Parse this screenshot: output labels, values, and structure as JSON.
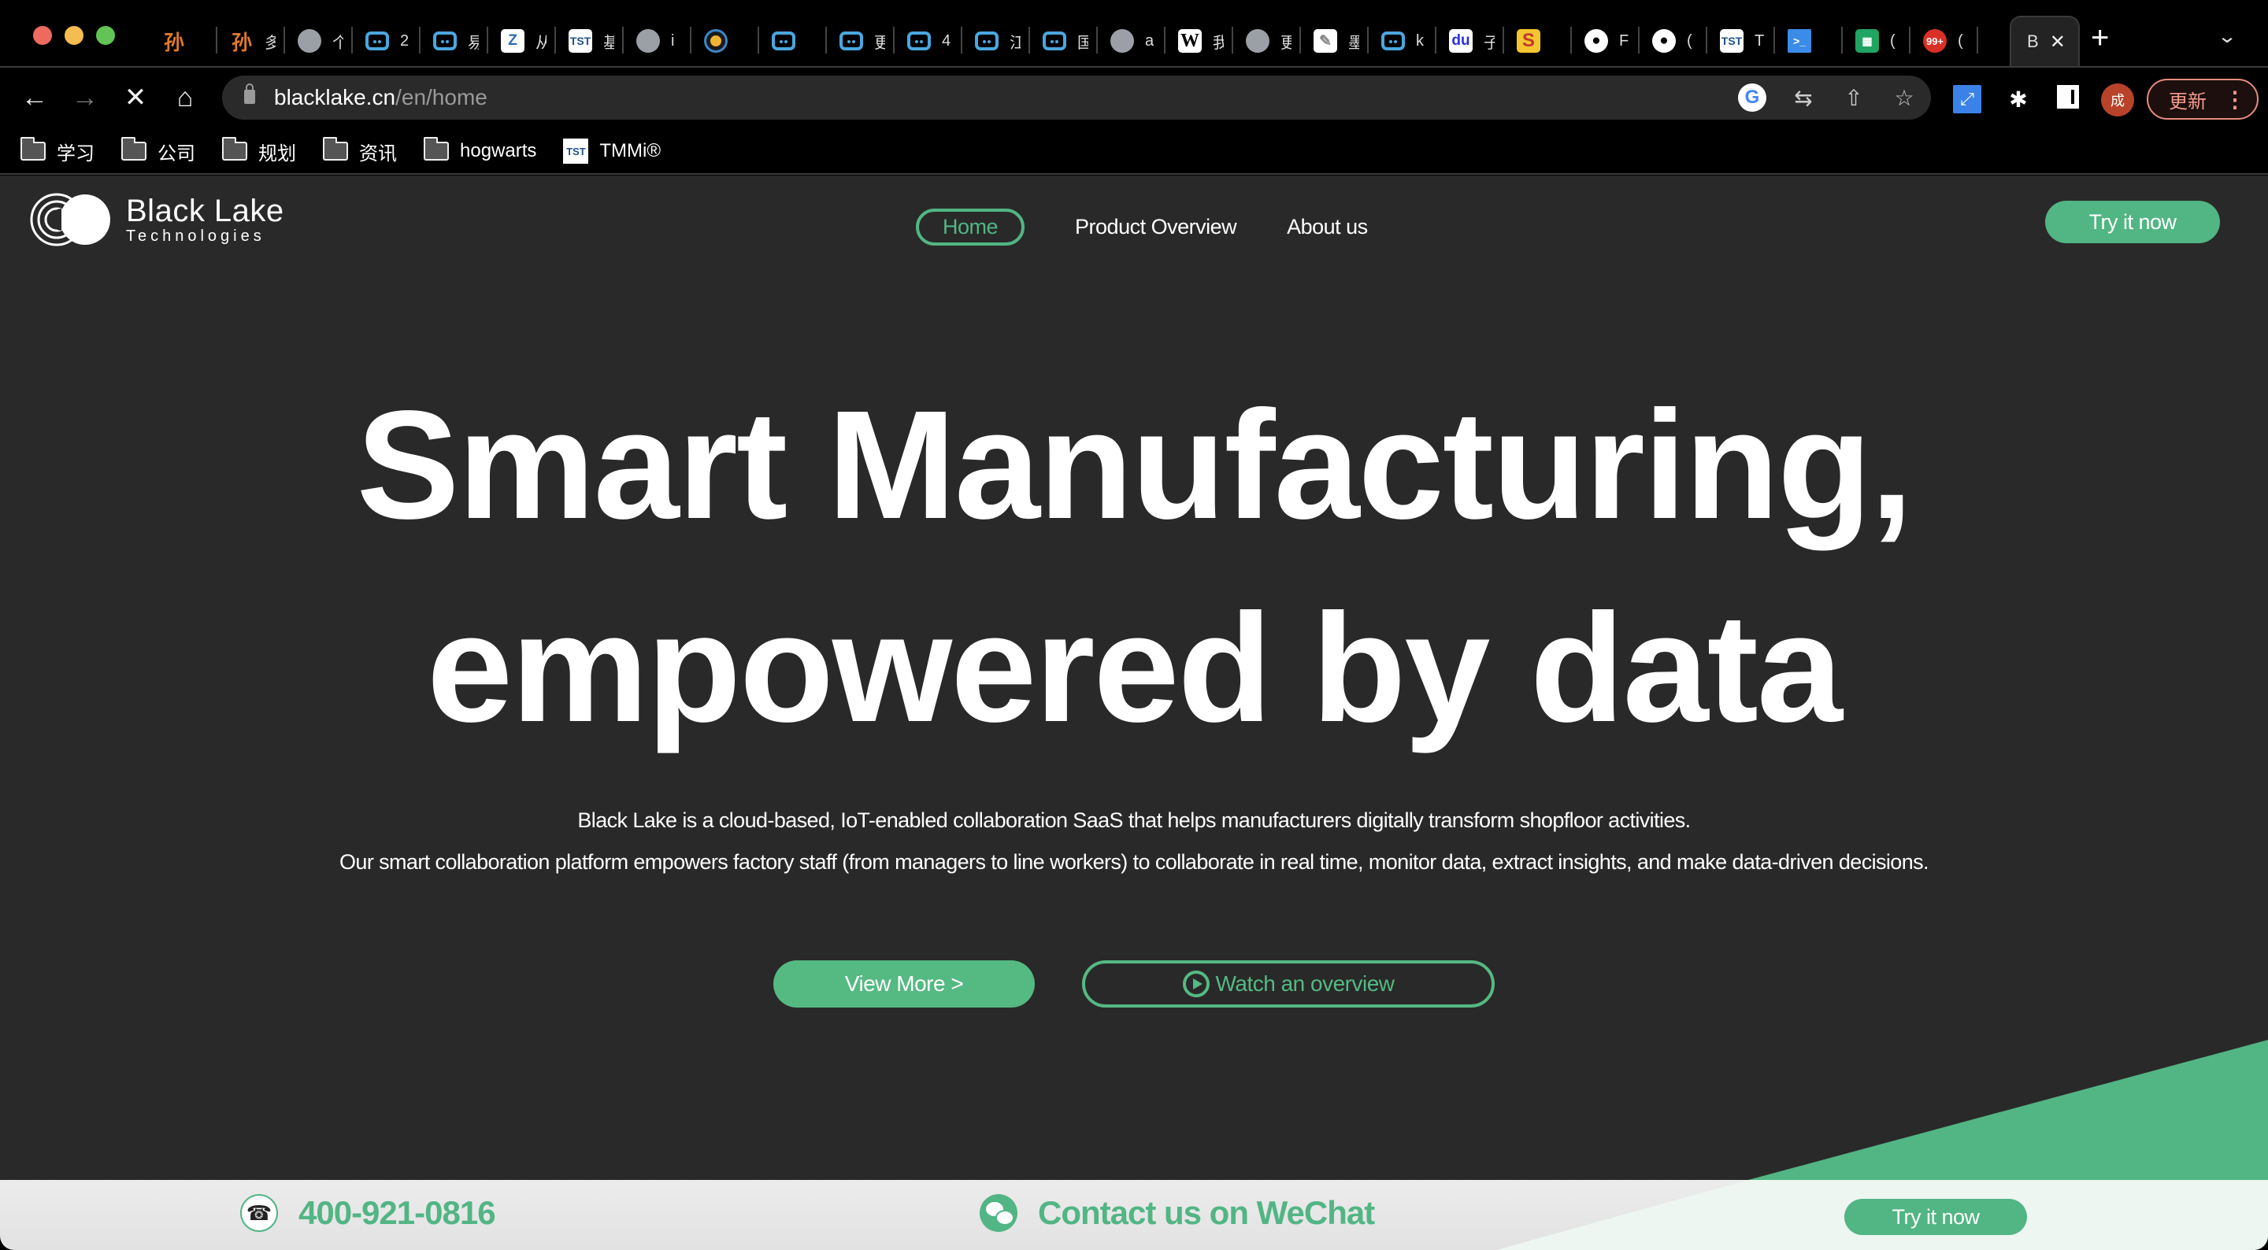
{
  "browser": {
    "tabs": [
      {
        "icon": "sun-icon",
        "glyph": "孙",
        "title": ""
      },
      {
        "icon": "sun-icon",
        "glyph": "孙",
        "title": "多"
      },
      {
        "icon": "globe-icon",
        "glyph": "",
        "title": "个"
      },
      {
        "icon": "bilibili-icon",
        "glyph": "",
        "title": "2"
      },
      {
        "icon": "bilibili-icon",
        "glyph": "",
        "title": "易"
      },
      {
        "icon": "zen-icon",
        "glyph": "Z",
        "title": "从"
      },
      {
        "icon": "tst-icon",
        "glyph": "TST",
        "title": "基"
      },
      {
        "icon": "globe-icon",
        "glyph": "",
        "title": "i"
      },
      {
        "icon": "orb-icon",
        "glyph": "",
        "title": ""
      },
      {
        "icon": "bilibili-icon",
        "glyph": "",
        "title": ""
      },
      {
        "icon": "bilibili-icon",
        "glyph": "",
        "title": "更"
      },
      {
        "icon": "bilibili-icon",
        "glyph": "",
        "title": "4"
      },
      {
        "icon": "bilibili-icon",
        "glyph": "",
        "title": "江"
      },
      {
        "icon": "bilibili-icon",
        "glyph": "",
        "title": "国"
      },
      {
        "icon": "globe-icon",
        "glyph": "",
        "title": "a"
      },
      {
        "icon": "wikipedia-icon",
        "glyph": "W",
        "title": "我"
      },
      {
        "icon": "globe-icon",
        "glyph": "",
        "title": "更"
      },
      {
        "icon": "pen-icon",
        "glyph": "✎",
        "title": "墨"
      },
      {
        "icon": "bilibili-icon",
        "glyph": "",
        "title": "k"
      },
      {
        "icon": "baidu-icon",
        "glyph": "du",
        "title": "子"
      },
      {
        "icon": "s-logo-icon",
        "glyph": "S",
        "title": ""
      },
      {
        "icon": "github-icon",
        "glyph": "●",
        "title": "F"
      },
      {
        "icon": "github-icon",
        "glyph": "●",
        "title": "("
      },
      {
        "icon": "tst-icon",
        "glyph": "TST",
        "title": "T"
      },
      {
        "icon": "terminal-icon",
        "glyph": ">_",
        "title": ""
      },
      {
        "icon": "sheets-icon",
        "glyph": "▦",
        "title": "("
      },
      {
        "icon": "mail-icon",
        "glyph": "99+",
        "title": "("
      }
    ],
    "active_tab": {
      "title": "B",
      "close": "✕"
    },
    "new_tab": "+",
    "tab_list": "⌄",
    "nav": {
      "back": "←",
      "forward": "→",
      "stop": "✕",
      "home": "⌂"
    },
    "url_host": "blacklake.cn",
    "url_path": "/en/home",
    "omnibox_icons": {
      "google": "G",
      "translate": "⇆",
      "share": "⇧",
      "bookmark": "☆"
    },
    "extensions": {
      "resize": "⤢",
      "puzzle": "✱"
    },
    "profile_initial": "成",
    "update_label": "更新",
    "menu": "⋮",
    "bookmarks": [
      {
        "type": "folder",
        "label": "学习"
      },
      {
        "type": "folder",
        "label": "公司"
      },
      {
        "type": "folder",
        "label": "规划"
      },
      {
        "type": "folder",
        "label": "资讯"
      },
      {
        "type": "folder",
        "label": "hogwarts"
      },
      {
        "type": "site",
        "label": "TMMi®",
        "icon_text": "TST"
      }
    ]
  },
  "site": {
    "logo": {
      "line1": "Black Lake",
      "line2": "Technologies"
    },
    "nav": [
      {
        "label": "Home",
        "active": true
      },
      {
        "label": "Product Overview",
        "active": false
      },
      {
        "label": "About us",
        "active": false
      }
    ],
    "cta_top": "Try it now",
    "hero": {
      "title_line1": "Smart Manufacturing,",
      "title_line2": "empowered by data",
      "desc_line1": "Black Lake is a cloud-based, IoT-enabled collaboration SaaS that helps manufacturers digitally transform shopfloor activities.",
      "desc_line2": "Our smart collaboration platform empowers factory staff (from managers to line workers) to collaborate in real time, monitor data, extract insights, and make data-driven decisions.",
      "view_more": "View More >",
      "watch_overview": "Watch an overview"
    },
    "bottom_bar": {
      "phone": "400-921-0816",
      "wechat": "Contact us on WeChat",
      "cta": "Try it now"
    },
    "colors": {
      "accent": "#52b584",
      "background": "#292929",
      "bottom_bar": "#e8e8e8"
    }
  }
}
